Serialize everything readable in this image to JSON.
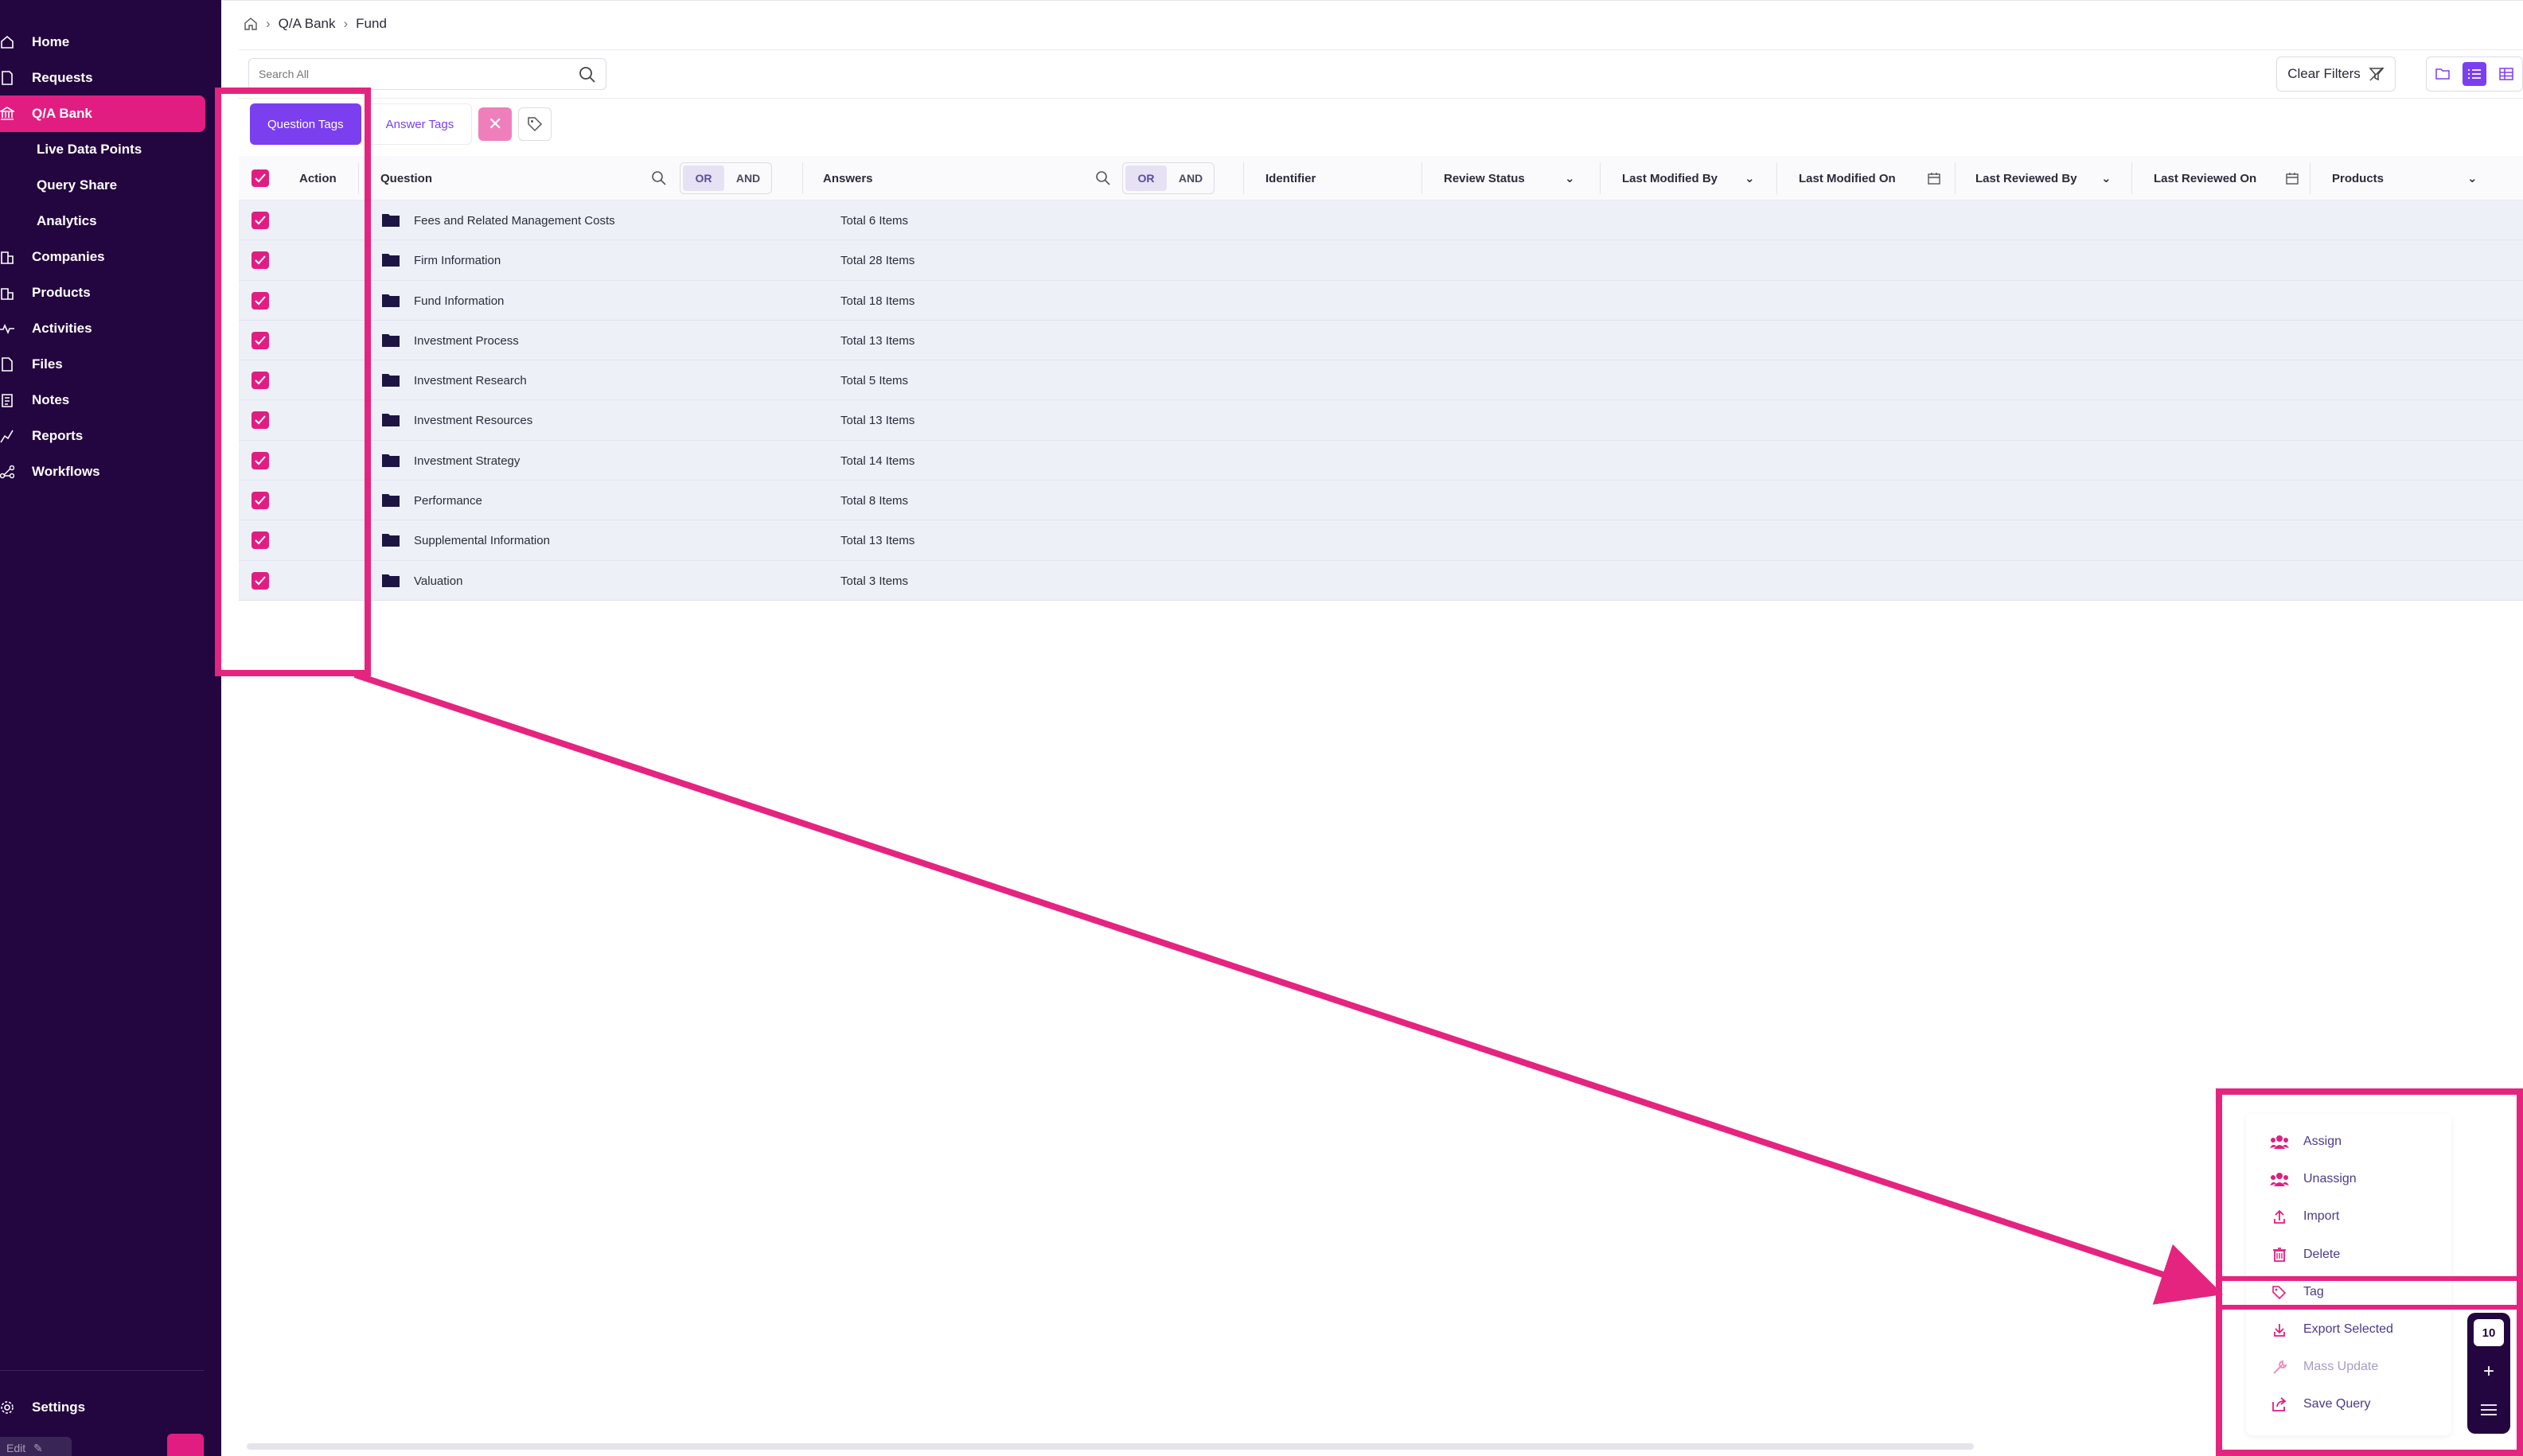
{
  "sidebar": {
    "items": [
      {
        "label": "Home",
        "icon": "home-icon"
      },
      {
        "label": "Requests",
        "icon": "document-icon"
      },
      {
        "label": "Q/A Bank",
        "icon": "bank-icon",
        "active": true
      },
      {
        "label": "Companies",
        "icon": "building-icon"
      },
      {
        "label": "Products",
        "icon": "box-icon"
      },
      {
        "label": "Activities",
        "icon": "pulse-icon"
      },
      {
        "label": "Files",
        "icon": "file-icon"
      },
      {
        "label": "Notes",
        "icon": "notes-icon"
      },
      {
        "label": "Reports",
        "icon": "chart-icon"
      },
      {
        "label": "Workflows",
        "icon": "workflow-icon"
      }
    ],
    "sub_items": [
      {
        "label": "Live Data Points"
      },
      {
        "label": "Query Share"
      },
      {
        "label": "Analytics"
      }
    ],
    "settings_label": "Settings",
    "edit_label": "Edit"
  },
  "breadcrumb": {
    "items": [
      "Q/A Bank",
      "Fund"
    ]
  },
  "toolbar": {
    "search_placeholder": "Search All",
    "clear_filters_label": "Clear Filters"
  },
  "tag_tabs": {
    "question_tags": "Question Tags",
    "answer_tags": "Answer Tags"
  },
  "table": {
    "headers": {
      "action": "Action",
      "question": "Question",
      "answers": "Answers",
      "identifier": "Identifier",
      "review_status": "Review Status",
      "last_modified_by": "Last Modified By",
      "last_modified_on": "Last Modified On",
      "last_reviewed_by": "Last Reviewed By",
      "last_reviewed_on": "Last Reviewed On",
      "products": "Products"
    },
    "or_label": "OR",
    "and_label": "AND",
    "rows": [
      {
        "question": "Fees and Related Management Costs",
        "answers": "Total 6 Items"
      },
      {
        "question": "Firm Information",
        "answers": "Total 28 Items"
      },
      {
        "question": "Fund Information",
        "answers": "Total 18 Items"
      },
      {
        "question": "Investment Process",
        "answers": "Total 13 Items"
      },
      {
        "question": "Investment Research",
        "answers": "Total 5 Items"
      },
      {
        "question": "Investment Resources",
        "answers": "Total 13 Items"
      },
      {
        "question": "Investment Strategy",
        "answers": "Total 14 Items"
      },
      {
        "question": "Performance",
        "answers": "Total 8 Items"
      },
      {
        "question": "Supplemental Information",
        "answers": "Total 13 Items"
      },
      {
        "question": "Valuation",
        "answers": "Total 3 Items"
      }
    ]
  },
  "action_menu": {
    "items": [
      {
        "label": "Assign",
        "icon": "users-icon"
      },
      {
        "label": "Unassign",
        "icon": "users-icon"
      },
      {
        "label": "Import",
        "icon": "upload-icon"
      },
      {
        "label": "Delete",
        "icon": "trash-icon"
      },
      {
        "label": "Tag",
        "icon": "tag-icon"
      },
      {
        "label": "Export Selected",
        "icon": "download-icon"
      },
      {
        "label": "Mass Update",
        "icon": "wrench-icon",
        "disabled": true
      },
      {
        "label": "Save Query",
        "icon": "share-icon"
      }
    ],
    "selected_count": "10"
  },
  "colors": {
    "sidebar_bg": "#23063f",
    "accent_pink": "#e21d82",
    "accent_purple": "#7b3ff0",
    "highlight": "#e5247f"
  }
}
